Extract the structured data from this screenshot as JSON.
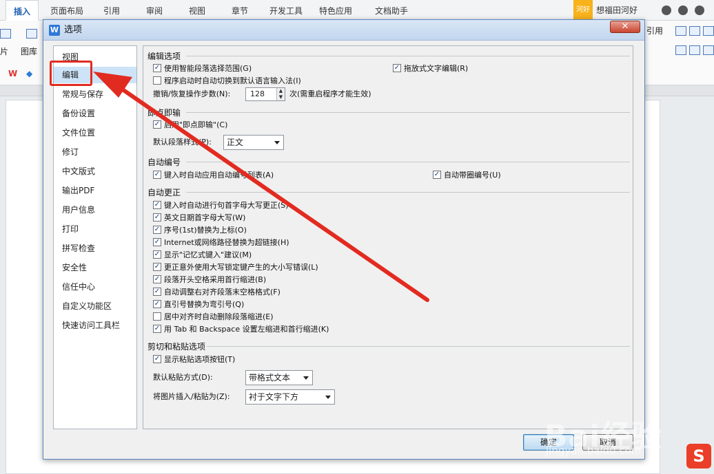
{
  "background_app": {
    "ribbon_tabs": [
      "插入",
      "页面布局",
      "引用",
      "审阅",
      "视图",
      "章节",
      "开发工具",
      "特色应用",
      "文档助手"
    ],
    "active_tab": "插入",
    "user_badge": "河好",
    "user_name": "想福田河好",
    "ribbon_labels": {
      "image_short": "片",
      "gallery": "图库",
      "reference": "引用"
    }
  },
  "dialog": {
    "title": "选项",
    "app_icon_letter": "W",
    "close_glyph": "✕",
    "nav_items": [
      {
        "label": "视图"
      },
      {
        "label": "编辑"
      },
      {
        "label": "常规与保存"
      },
      {
        "label": "备份设置"
      },
      {
        "label": "文件位置"
      },
      {
        "label": "修订"
      },
      {
        "label": "中文版式"
      },
      {
        "label": "输出PDF"
      },
      {
        "label": "用户信息"
      },
      {
        "label": "打印"
      },
      {
        "label": "拼写检查"
      },
      {
        "label": "安全性"
      },
      {
        "label": "信任中心"
      },
      {
        "label": "自定义功能区"
      },
      {
        "label": "快速访问工具栏"
      }
    ],
    "selected_nav": "编辑",
    "sections": {
      "edit_options": {
        "header": "编辑选项",
        "smart_paragraph": {
          "label": "使用智能段落选择范围(G)",
          "checked": true
        },
        "drag_drop": {
          "label": "拖放式文字编辑(R)",
          "checked": true
        },
        "auto_ime": {
          "label": "程序启动时自动切换到默认语言输入法(I)",
          "checked": false
        },
        "undo_steps_label": "撤销/恢复操作步数(N):",
        "undo_steps_value": "128",
        "undo_steps_suffix": "次(需重启程序才能生效)"
      },
      "click_and_type": {
        "header": "即点即输",
        "enable": {
          "label": "启用\"即点即输\"(C)",
          "checked": true
        },
        "default_style_label": "默认段落样式(P):",
        "default_style_value": "正文"
      },
      "auto_numbering": {
        "header": "自动编号",
        "auto_list": {
          "label": "键入时自动应用自动编号列表(A)",
          "checked": true
        },
        "circle_number": {
          "label": "自动带圈编号(U)",
          "checked": true
        }
      },
      "autocorrect": {
        "header": "自动更正",
        "items": [
          {
            "label": "键入时自动进行句首字母大写更正(S)",
            "checked": true
          },
          {
            "label": "英文日期首字母大写(W)",
            "checked": true
          },
          {
            "label": "序号(1st)替换为上标(O)",
            "checked": true
          },
          {
            "label": "Internet或网络路径替换为超链接(H)",
            "checked": true
          },
          {
            "label": "显示\"记忆式键入\"建议(M)",
            "checked": true
          },
          {
            "label": "更正意外使用大写锁定键产生的大小写错误(L)",
            "checked": true
          },
          {
            "label": "段落开头空格采用首行缩进(B)",
            "checked": true
          },
          {
            "label": "自动调整右对齐段落末空格格式(F)",
            "checked": true
          },
          {
            "label": "直引号替换为弯引号(Q)",
            "checked": true
          },
          {
            "label": "居中对齐时自动删除段落缩进(E)",
            "checked": false
          },
          {
            "label": "用 Tab 和 Backspace 设置左缩进和首行缩进(K)",
            "checked": true
          }
        ]
      },
      "cut_paste": {
        "header": "剪切和粘贴选项",
        "show_paste_button": {
          "label": "显示粘贴选项按钮(T)",
          "checked": true
        },
        "default_paste_label": "默认粘贴方式(D):",
        "default_paste_value": "带格式文本",
        "image_insert_label": "将图片插入/粘贴为(Z):",
        "image_insert_value": "衬于文字下方"
      }
    },
    "buttons": {
      "ok": "确定",
      "cancel": "取消"
    }
  },
  "watermark": {
    "brand": "Bai经验",
    "url": "jingyan.baidu.com"
  },
  "ime_logo_letter": "S",
  "colors": {
    "annotation_red": "#e22b20",
    "selection_blue": "#cde3f8",
    "title_bar": "#c2d6ee"
  }
}
